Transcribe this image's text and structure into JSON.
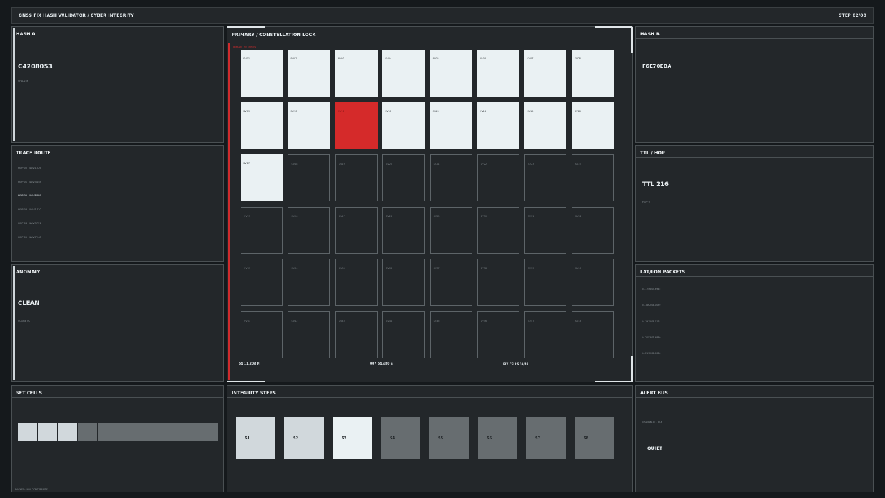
{
  "header": {
    "title": "GNSS FIX HASH VALIDATOR  /  CYBER INTEGRITY",
    "step": "STEP 02/08"
  },
  "hash_a": {
    "title": "HASH A",
    "value": "C4208053",
    "sub": "SHA-256"
  },
  "trace": {
    "title": "TRACE ROUTE",
    "hops": [
      "HOP 00 · NAV-1026",
      "HOP 01 · NAV-4458",
      "HOP 02 · NAV-8889",
      "HOP 03 · NAV-1770",
      "HOP 04 · NAV-3751",
      "HOP 05 · NAV-7248"
    ],
    "active_index": 2
  },
  "anomaly": {
    "title": "ANOMALY",
    "value": "CLEAN",
    "score": "SCORE 00"
  },
  "set_cells": {
    "title": "SET CELLS",
    "cells": [
      1,
      1,
      1,
      0,
      0,
      0,
      0,
      0,
      0,
      0
    ],
    "footer": "MASKED · NAV CONSTRAINTS"
  },
  "center": {
    "title": "PRIMARY  /  CONSTELLATION LOCK",
    "red_label": "PRIMARY · SV CHECKS",
    "sats": [
      {
        "id": "SV01",
        "state": "lock"
      },
      {
        "id": "SV02",
        "state": "lock"
      },
      {
        "id": "SV03",
        "state": "lock"
      },
      {
        "id": "SV04",
        "state": "lock"
      },
      {
        "id": "SV05",
        "state": "lock"
      },
      {
        "id": "SV06",
        "state": "lock"
      },
      {
        "id": "SV07",
        "state": "lock"
      },
      {
        "id": "SV08",
        "state": "lock"
      },
      {
        "id": "SV09",
        "state": "lock"
      },
      {
        "id": "SV10",
        "state": "lock"
      },
      {
        "id": "SV11",
        "state": "alert"
      },
      {
        "id": "SV12",
        "state": "lock"
      },
      {
        "id": "SV13",
        "state": "lock"
      },
      {
        "id": "SV14",
        "state": "lock"
      },
      {
        "id": "SV15",
        "state": "lock"
      },
      {
        "id": "SV16",
        "state": "lock"
      },
      {
        "id": "SV17",
        "state": "lock"
      },
      {
        "id": "SV18",
        "state": "empty"
      },
      {
        "id": "SV19",
        "state": "empty"
      },
      {
        "id": "SV20",
        "state": "empty"
      },
      {
        "id": "SV21",
        "state": "empty"
      },
      {
        "id": "SV22",
        "state": "empty"
      },
      {
        "id": "SV23",
        "state": "empty"
      },
      {
        "id": "SV24",
        "state": "empty"
      },
      {
        "id": "SV25",
        "state": "empty"
      },
      {
        "id": "SV26",
        "state": "empty"
      },
      {
        "id": "SV27",
        "state": "empty"
      },
      {
        "id": "SV28",
        "state": "empty"
      },
      {
        "id": "SV29",
        "state": "empty"
      },
      {
        "id": "SV30",
        "state": "empty"
      },
      {
        "id": "SV31",
        "state": "empty"
      },
      {
        "id": "SV32",
        "state": "empty"
      },
      {
        "id": "SV33",
        "state": "empty"
      },
      {
        "id": "SV34",
        "state": "empty"
      },
      {
        "id": "SV35",
        "state": "empty"
      },
      {
        "id": "SV36",
        "state": "empty"
      },
      {
        "id": "SV37",
        "state": "empty"
      },
      {
        "id": "SV38",
        "state": "empty"
      },
      {
        "id": "SV39",
        "state": "empty"
      },
      {
        "id": "SV40",
        "state": "empty"
      },
      {
        "id": "SV41",
        "state": "empty"
      },
      {
        "id": "SV42",
        "state": "empty"
      },
      {
        "id": "SV43",
        "state": "empty"
      },
      {
        "id": "SV44",
        "state": "empty"
      },
      {
        "id": "SV45",
        "state": "empty"
      },
      {
        "id": "SV46",
        "state": "empty"
      },
      {
        "id": "SV47",
        "state": "empty"
      },
      {
        "id": "SV48",
        "state": "empty"
      }
    ],
    "lat": "54 11.208 N",
    "lon": "007 54.480 E",
    "fix_cells": "FIX CELLS 16/48"
  },
  "hash_b": {
    "title": "HASH B",
    "value": "F6E70EBA"
  },
  "ttl": {
    "title": "TTL / HOP",
    "value": "TTL 216",
    "hop": "HOP 0"
  },
  "packets": {
    "title": "LAT/LON PACKETS",
    "items": [
      "54.1746 07.9945",
      "54.1862 08.0039",
      "54.1915 08.0174",
      "54.2053 07.9880",
      "54.2112 08.0066"
    ]
  },
  "integrity": {
    "title": "INTEGRITY STEPS",
    "steps": [
      {
        "label": "S1",
        "state": "done"
      },
      {
        "label": "S2",
        "state": "done"
      },
      {
        "label": "S3",
        "state": "cur"
      },
      {
        "label": "S4",
        "state": "todo"
      },
      {
        "label": "S5",
        "state": "todo"
      },
      {
        "label": "S6",
        "state": "todo"
      },
      {
        "label": "S7",
        "state": "todo"
      },
      {
        "label": "S8",
        "state": "todo"
      }
    ]
  },
  "alert": {
    "title": "ALERT BUS",
    "note": "CHANNEL 00 · IDLE",
    "status": "QUIET"
  },
  "colors": {
    "bg": "#15191c",
    "panel": "#23272a",
    "lock": "#eaf1f3",
    "alert": "#d52a2a",
    "done": "#d1d8dc",
    "todo": "#676d70"
  }
}
